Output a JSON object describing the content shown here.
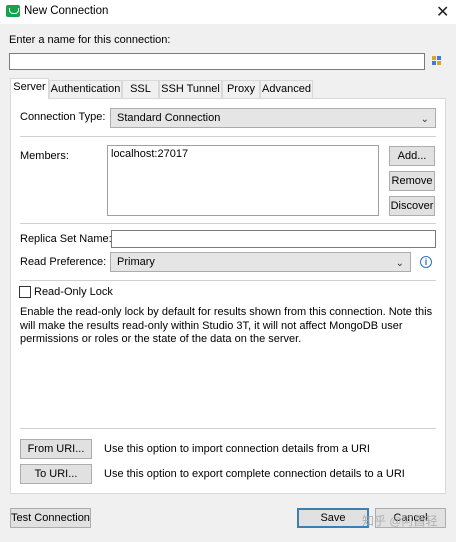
{
  "window": {
    "title": "New Connection",
    "close_glyph": "✕"
  },
  "name_section": {
    "label": "Enter a name for this connection:",
    "value": ""
  },
  "tabs": [
    "Server",
    "Authentication",
    "SSL",
    "SSH Tunnel",
    "Proxy",
    "Advanced"
  ],
  "active_tab": "Server",
  "server": {
    "connection_type_label": "Connection Type:",
    "connection_type_value": "Standard Connection",
    "members_label": "Members:",
    "members": [
      "localhost:27017"
    ],
    "add_button": "Add...",
    "remove_button": "Remove",
    "discover_button": "Discover",
    "replica_set_label": "Replica Set Name:",
    "replica_set_value": "",
    "read_pref_label": "Read Preference:",
    "read_pref_value": "Primary",
    "readonly_lock_label": "Read-Only Lock",
    "readonly_lock_checked": false,
    "readonly_description": "Enable the read-only lock by default for results shown from this connection. Note this will make the results read-only within Studio 3T, it will not affect MongoDB user permissions or roles or the state of the data on the server.",
    "from_uri_button": "From URI...",
    "from_uri_desc": "Use this option to import connection details from a URI",
    "to_uri_button": "To URI...",
    "to_uri_desc": "Use this option to export complete connection details to a URI"
  },
  "footer": {
    "test_button": "Test Connection",
    "save_button": "Save",
    "cancel_button": "Cancel",
    "watermark": "知乎 @阿昌轻"
  },
  "icons": {
    "app": "studio3t-app-icon",
    "name_field_action": "grid-icon",
    "info": "info-icon"
  },
  "colors": {
    "app_icon": "#17a34a",
    "focus_border": "#3c7fb1",
    "info": "#2f6fd6"
  }
}
